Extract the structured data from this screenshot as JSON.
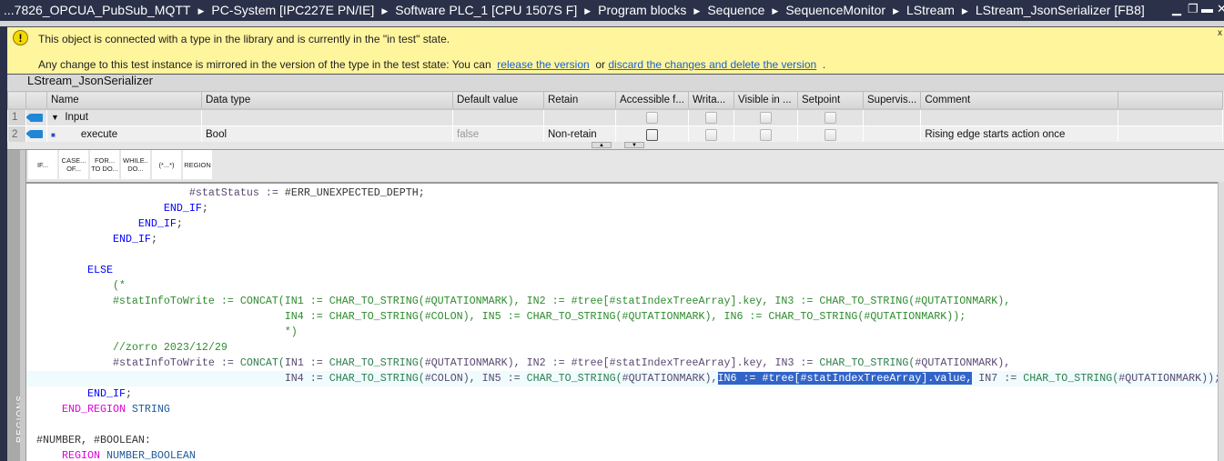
{
  "titlebar": {
    "breadcrumbs": [
      "...7826_OPCUA_PubSub_MQTT",
      "PC-System [IPC227E PN/IE]",
      "Software PLC_1 [CPU 1507S F]",
      "Program blocks",
      "Sequence",
      "SequenceMonitor",
      "LStream",
      "LStream_JsonSerializer [FB8]"
    ],
    "separator": "▶",
    "minimize": "▁",
    "restore": "❐",
    "maximize": "▬",
    "close": "✕"
  },
  "banner": {
    "icon": "!",
    "line1": "This object is connected with a type in the library and is currently in the \"in test\" state.",
    "line2_prefix": "Any change to this test instance is mirrored in the version of the type in the test state: You can",
    "link1": "release the version",
    "or": "or",
    "link2": "discard the changes and delete the version",
    "suffix": ".",
    "close": "x"
  },
  "block": {
    "name": "LStream_JsonSerializer"
  },
  "table": {
    "headers": [
      "Name",
      "Data type",
      "Default value",
      "Retain",
      "Accessible f...",
      "Writa...",
      "Visible in ...",
      "Setpoint",
      "Supervis...",
      "Comment"
    ],
    "rows": [
      {
        "num": "1",
        "expander": "▼",
        "name": "Input",
        "datatype": "",
        "default": "",
        "retain": "",
        "comment": ""
      },
      {
        "num": "2",
        "expander": "■",
        "name": "execute",
        "datatype": "Bool",
        "default": "false",
        "retain": "Non-retain",
        "comment": "Rising edge starts action once"
      }
    ]
  },
  "toolbar": {
    "buttons": [
      "IF...",
      "CASE...\nOF...",
      "FOR...\nTO DO...",
      "WHILE..\nDO...",
      "(*...*)",
      "REGION"
    ]
  },
  "sidebar": {
    "label": "REGIONS"
  },
  "code": [
    {
      "t": [
        [
          "                        ",
          ""
        ],
        [
          "#statStatus := ",
          "id"
        ],
        [
          "#ERR_UNEXPECTED_DEPTH;",
          "tx"
        ]
      ]
    },
    {
      "t": [
        [
          "                    ",
          ""
        ],
        [
          "END_IF",
          "kw"
        ],
        [
          ";",
          "tx"
        ]
      ]
    },
    {
      "t": [
        [
          "                ",
          ""
        ],
        [
          "END_IF",
          "kw"
        ],
        [
          ";",
          "tx"
        ]
      ]
    },
    {
      "t": [
        [
          "            ",
          ""
        ],
        [
          "END_IF",
          "kw"
        ],
        [
          ";",
          "tx"
        ]
      ]
    },
    {
      "t": []
    },
    {
      "t": [
        [
          "        ",
          ""
        ],
        [
          "ELSE",
          "kw"
        ]
      ]
    },
    {
      "t": [
        [
          "            (*",
          "cm"
        ]
      ]
    },
    {
      "t": [
        [
          "            #statInfoToWrite := CONCAT(IN1 := CHAR_TO_STRING(#QUTATIONMARK), IN2 := #tree[#statIndexTreeArray].key, IN3 := CHAR_TO_STRING(#QUTATIONMARK),",
          "cm"
        ]
      ]
    },
    {
      "t": [
        [
          "                                       IN4 := CHAR_TO_STRING(#COLON), IN5 := CHAR_TO_STRING(#QUTATIONMARK), IN6 := CHAR_TO_STRING(#QUTATIONMARK));",
          "cm"
        ]
      ]
    },
    {
      "t": [
        [
          "                                       *)",
          "cm"
        ]
      ]
    },
    {
      "t": [
        [
          "            //zorro 2023/12/29",
          "cm"
        ]
      ]
    },
    {
      "t": [
        [
          "            ",
          ""
        ],
        [
          "#statInfoToWrite := ",
          "id"
        ],
        [
          "CONCAT(",
          "fn"
        ],
        [
          "IN1 := ",
          "id"
        ],
        [
          "CHAR_TO_STRING(",
          "fn"
        ],
        [
          "#QUTATIONMARK), ",
          "id"
        ],
        [
          "IN2 := #tree[#statIndexTreeArray].key, IN3 := ",
          "id"
        ],
        [
          "CHAR_TO_STRING(",
          "fn"
        ],
        [
          "#QUTATIONMARK),",
          "id"
        ]
      ]
    },
    {
      "active": true,
      "t": [
        [
          "                                       ",
          ""
        ],
        [
          "IN4 := ",
          "id"
        ],
        [
          "CHAR_TO_STRING(",
          "fn"
        ],
        [
          "#COLON), IN5 := ",
          "id"
        ],
        [
          "CHAR_TO_STRING(",
          "fn"
        ],
        [
          "#QUTATIONMARK),",
          "id"
        ],
        [
          "IN6 := #tree[#statIndexTreeArray].value,",
          "sel"
        ],
        [
          " IN7 := ",
          "id"
        ],
        [
          "CHAR_TO_STRING(",
          "fn"
        ],
        [
          "#QUTATIONMARK));",
          "id"
        ]
      ]
    },
    {
      "t": [
        [
          "        ",
          ""
        ],
        [
          "END_IF",
          "kw"
        ],
        [
          ";",
          "tx"
        ]
      ]
    },
    {
      "t": [
        [
          "    ",
          ""
        ],
        [
          "END_REGION",
          "rg"
        ],
        [
          " STRING",
          "ty"
        ]
      ]
    },
    {
      "t": []
    },
    {
      "t": [
        [
          "#NUMBER, #BOOLEAN:",
          "tx"
        ]
      ]
    },
    {
      "t": [
        [
          "    ",
          ""
        ],
        [
          "REGION",
          "rg"
        ],
        [
          " NUMBER_BOOLEAN",
          "ty"
        ]
      ]
    }
  ]
}
